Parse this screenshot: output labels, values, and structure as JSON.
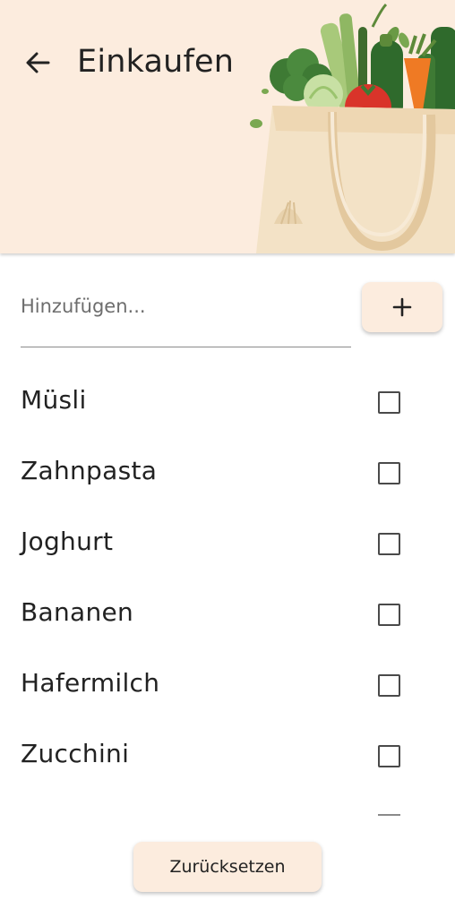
{
  "header": {
    "title": "Einkaufen",
    "background_color": "#fcecde",
    "back_icon": "arrow-left-icon",
    "illustration": "grocery-bag-with-vegetables"
  },
  "add_item": {
    "placeholder": "Hinzufügen...",
    "value": "",
    "button_label": "+"
  },
  "list": {
    "items": [
      {
        "label": "Müsli",
        "checked": false
      },
      {
        "label": "Zahnpasta",
        "checked": false
      },
      {
        "label": "Joghurt",
        "checked": false
      },
      {
        "label": "Bananen",
        "checked": false
      },
      {
        "label": "Hafermilch",
        "checked": false
      },
      {
        "label": "Zucchini",
        "checked": false
      }
    ]
  },
  "footer": {
    "reset_label": "Zurücksetzen"
  }
}
